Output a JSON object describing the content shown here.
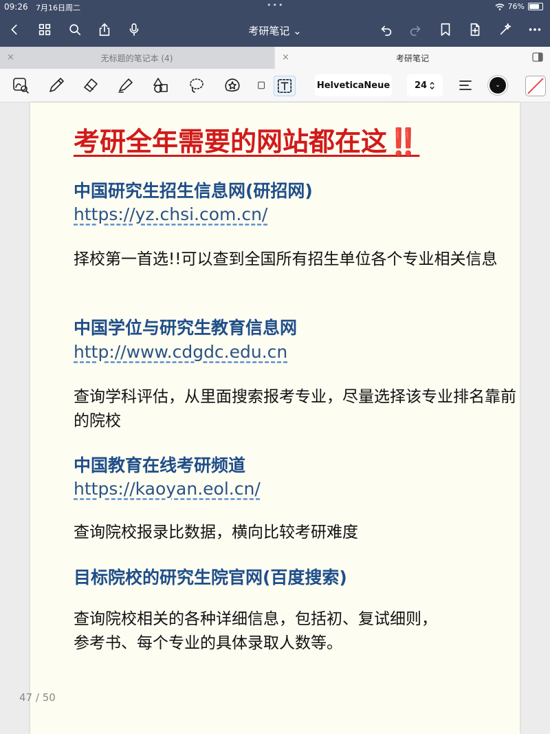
{
  "status_bar": {
    "time": "09:26",
    "date": "7月16日周二",
    "dots": "•••",
    "battery": "76%",
    "battery_level": 0.76
  },
  "nav": {
    "title": "考研笔记",
    "title_chevron": "⌄"
  },
  "tabs": [
    {
      "label": "无标题的笔记本 (4)",
      "close": "×"
    },
    {
      "label": "考研笔记",
      "close": "×"
    }
  ],
  "toolbar": {
    "font_name": "HelveticaNeue",
    "font_size": "24",
    "color": "#111111",
    "color_indicator": "⌄"
  },
  "page": {
    "title": "考研全年需要的网站都在这‼️",
    "sections": [
      {
        "heading": "中国研究生招生信息网(研招网)",
        "link": " https://yz.chsi.com.cn/",
        "desc": "择校第一首选!!可以查到全国所有招生单位各个专业相关信息"
      },
      {
        "heading": "中国学位与研究生教育信息网",
        "link": "http://www.cdgdc.edu.cn",
        "desc": "查询学科评估，从里面搜索报考专业，尽量选择该专业排名靠前的院校"
      },
      {
        "heading": "中国教育在线考研频道",
        "link": "https://kaoyan.eol.cn/",
        "desc": "查询院校报录比数据，横向比较考研难度"
      },
      {
        "heading": "目标院校的研究生院官网(百度搜索)",
        "desc_line1": "查询院校相关的各种详细信息，包括初、复试细则，",
        "desc_line2": "参考书、每个专业的具体录取人数等。"
      }
    ],
    "counter_current": "47",
    "counter_sep": " / ",
    "counter_total": "50"
  },
  "colors": {
    "nav_bg": "#3c4a66",
    "title_red": "#d11a1a",
    "heading_blue": "#1f4e89",
    "paper": "#fefdf2"
  }
}
